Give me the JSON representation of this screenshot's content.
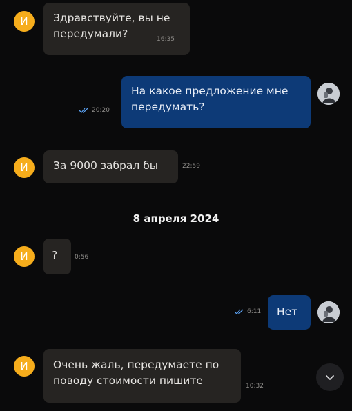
{
  "messages": [
    {
      "id": "m1",
      "direction": "incoming",
      "avatar_letter": "И",
      "text": "Здравствуйте, вы не\nпередумали?",
      "time": "16:35"
    },
    {
      "id": "m2",
      "direction": "outgoing",
      "text": "На какое предложение мне\nпередумать?",
      "time": "20:20",
      "status": "read"
    },
    {
      "id": "m3",
      "direction": "incoming",
      "avatar_letter": "И",
      "text": "За 9000 забрал бы",
      "time": "22:59"
    },
    {
      "id": "m4",
      "direction": "incoming",
      "avatar_letter": "И",
      "text": "?",
      "time": "0:56"
    },
    {
      "id": "m5",
      "direction": "outgoing",
      "text": "Нет",
      "time": "6:11",
      "status": "read"
    },
    {
      "id": "m6",
      "direction": "incoming",
      "avatar_letter": "И",
      "text": "Очень жаль, передумаете по\nповоду стоимости пишите",
      "time": "10:32"
    }
  ],
  "date_separator": "8 апреля 2024",
  "colors": {
    "background": "#0a0a0b",
    "incoming_bubble": "#262422",
    "outgoing_bubble": "#0d3a77",
    "avatar_incoming": "#f6ad1c",
    "read_ticks": "#5aa0f0"
  },
  "icons": {
    "read_status": "double-check-icon",
    "scroll_down": "chevron-down-icon",
    "user_avatar": "user-avatar-photo"
  }
}
